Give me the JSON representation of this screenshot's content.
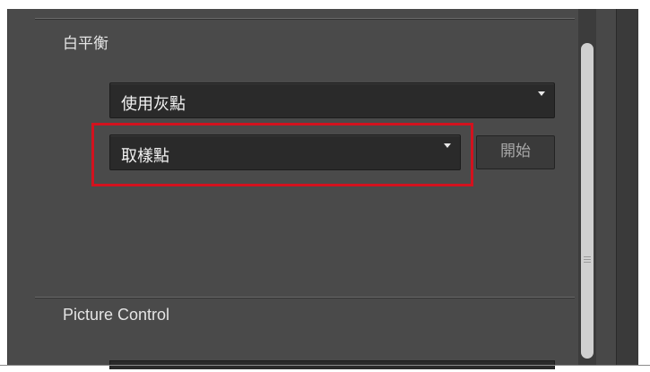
{
  "white_balance": {
    "title": "白平衡",
    "method_dropdown": {
      "value": "使用灰點"
    },
    "sample_dropdown": {
      "value": "取樣點"
    },
    "start_button": {
      "label": "開始"
    }
  },
  "picture_control": {
    "title": "Picture Control"
  },
  "colors": {
    "panel_bg": "#4a4a4a",
    "control_bg": "#2a2a2a",
    "highlight": "#d3121e",
    "text": "#e4e4e4"
  }
}
